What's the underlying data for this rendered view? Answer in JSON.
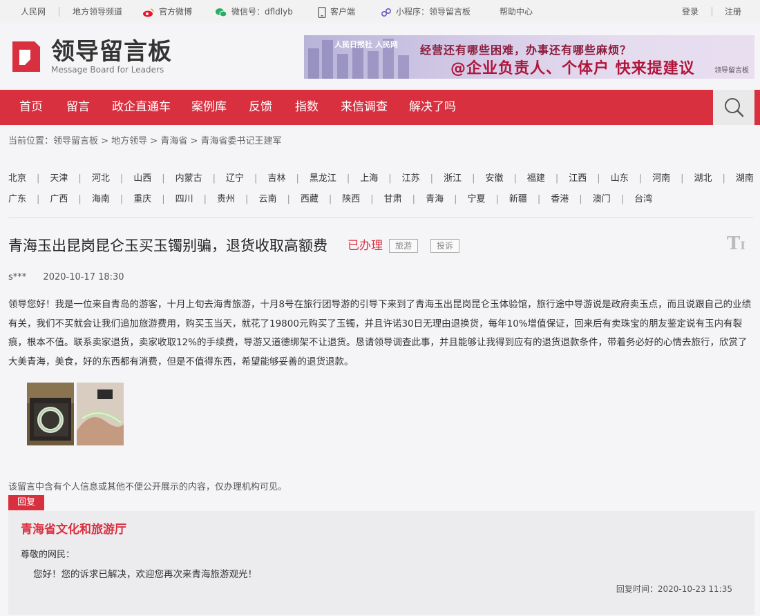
{
  "topbar": {
    "people": "人民网",
    "channel": "地方领导频道",
    "weibo": "官方微博",
    "wechat": "微信号：dfldlyb",
    "client": "客户端",
    "miniprogram": "小程序：领导留言板",
    "help": "帮助中心",
    "login": "登录",
    "register": "注册"
  },
  "header": {
    "logo_cn": "领导留言板",
    "logo_en": "Message Board for Leaders",
    "banner_logo": "人民日报社  人民网",
    "banner_line1": "经营还有哪些困难，办事还有哪些麻烦？",
    "banner_line2": "@企业负责人、个体户  快来提建议",
    "banner_mark": "领导留言板"
  },
  "nav": [
    "首页",
    "留言",
    "政企直通车",
    "案例库",
    "反馈",
    "指数",
    "来信调查",
    "解决了吗"
  ],
  "breadcrumb": "当前位置：领导留言板 > 地方领导 > 青海省 > 青海省委书记王建军",
  "provinces": {
    "row1": [
      "北京",
      "天津",
      "河北",
      "山西",
      "内蒙古",
      "辽宁",
      "吉林",
      "黑龙江",
      "上海",
      "江苏",
      "浙江",
      "安徽",
      "福建",
      "江西",
      "山东",
      "河南",
      "湖北",
      "湖南"
    ],
    "row2": [
      "广东",
      "广西",
      "海南",
      "重庆",
      "四川",
      "贵州",
      "云南",
      "西藏",
      "陕西",
      "甘肃",
      "青海",
      "宁夏",
      "新疆",
      "香港",
      "澳门",
      "台湾"
    ]
  },
  "message": {
    "title": "青海玉出昆岗昆仑玉买玉镯别骗，退货收取高额费",
    "status": "已办理",
    "tags": [
      "旅游",
      "投诉"
    ],
    "author": "s***",
    "time": "2020-10-17 18:30",
    "content": "领导您好！我是一位来自青岛的游客，十月上旬去海青旅游，十月8号在旅行团导游的引导下来到了青海玉出昆岗昆仑玉体验馆，旅行途中导游说是政府卖玉点，而且说跟自己的业绩有关，我们不买就会让我们追加旅游费用，购买玉当天，就花了19800元购买了玉镯，并且许诺30日无理由退换货，每年10%增值保证，回来后有卖珠宝的朋友鉴定说有玉内有裂痕，根本不值。联系卖家退货，卖家收取12%的手续费，导游又道德绑架不让退货。恳请领导调查此事，并且能够让我得到应有的退货退款条件，带着务必好的心情去旅行，欣赏了大美青海，美食，好的东西都有消费，但是不值得东西，希望能够妥善的退货退款。",
    "privacy": "该留言中含有个人信息或其他不便公开展示的内容，仅办理机构可见。"
  },
  "reply": {
    "tab": "回复",
    "replier": "青海省文化和旅游厅",
    "salute": "尊敬的网民：",
    "body": "您好！您的诉求已解决，欢迎您再次来青海旅游观光！",
    "time": "回复时间：2020-10-23 11:35"
  },
  "colors": {
    "brand_red": "#d9303f"
  },
  "icons": [
    "weibo-icon",
    "wechat-icon",
    "phone-icon",
    "miniprogram-icon",
    "search-icon",
    "font-size-icon"
  ]
}
